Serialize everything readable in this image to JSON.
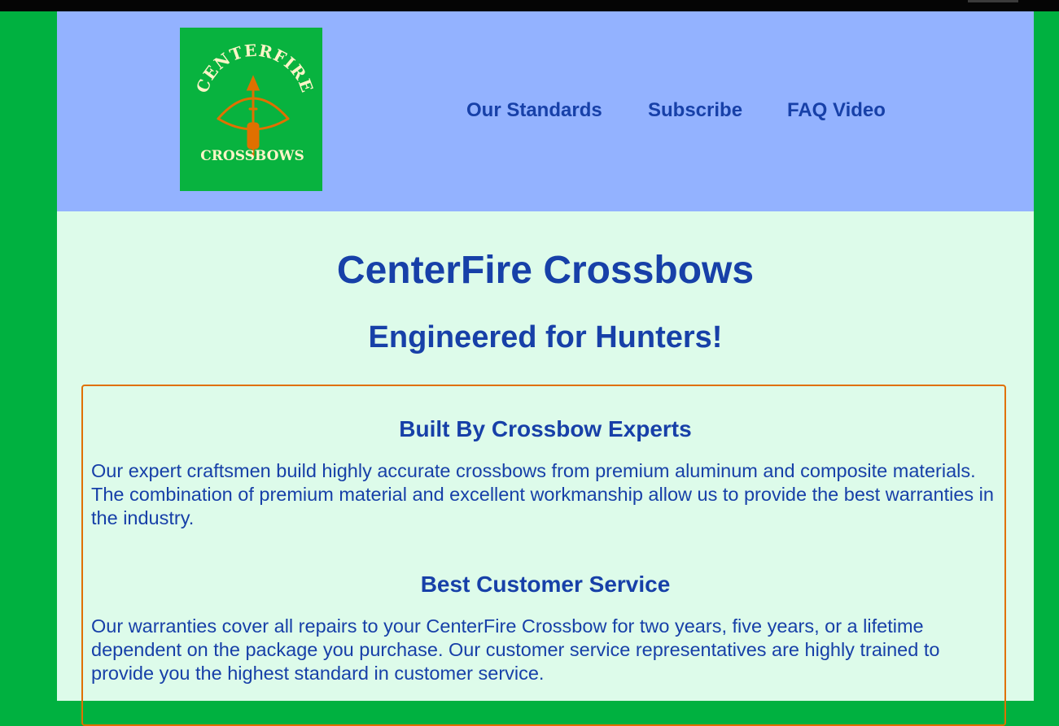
{
  "brand": {
    "logo_top_text": "CENTERFIRE",
    "logo_bottom_text": "CROSSBOWS",
    "logo_icon": "crossbow-icon"
  },
  "nav": {
    "items": [
      {
        "label": "Our Standards"
      },
      {
        "label": "Subscribe"
      },
      {
        "label": "FAQ Video"
      }
    ]
  },
  "hero": {
    "title": "CenterFire Crossbows",
    "subtitle": "Engineered for Hunters!"
  },
  "features": [
    {
      "heading": "Built By Crossbow Experts",
      "body": "Our expert craftsmen build highly accurate crossbows from premium aluminum and composite materials. The combination of premium material and excellent workmanship allow us to provide the best warranties in the industry."
    },
    {
      "heading": "Best Customer Service",
      "body": "Our warranties cover all repairs to your CenterFire Crossbow for two years, five years, or a lifetime dependent on the package you purchase. Our customer service representatives are highly trained to provide you the highest standard in customer service."
    }
  ],
  "colors": {
    "outer_background": "#00b140",
    "header_background": "#93b2ff",
    "content_background": "#ddfbea",
    "text_blue": "#1740a8",
    "card_border": "#e07000",
    "logo_background": "#08b33f",
    "logo_text": "#fff5c8",
    "logo_icon": "#e07000"
  }
}
